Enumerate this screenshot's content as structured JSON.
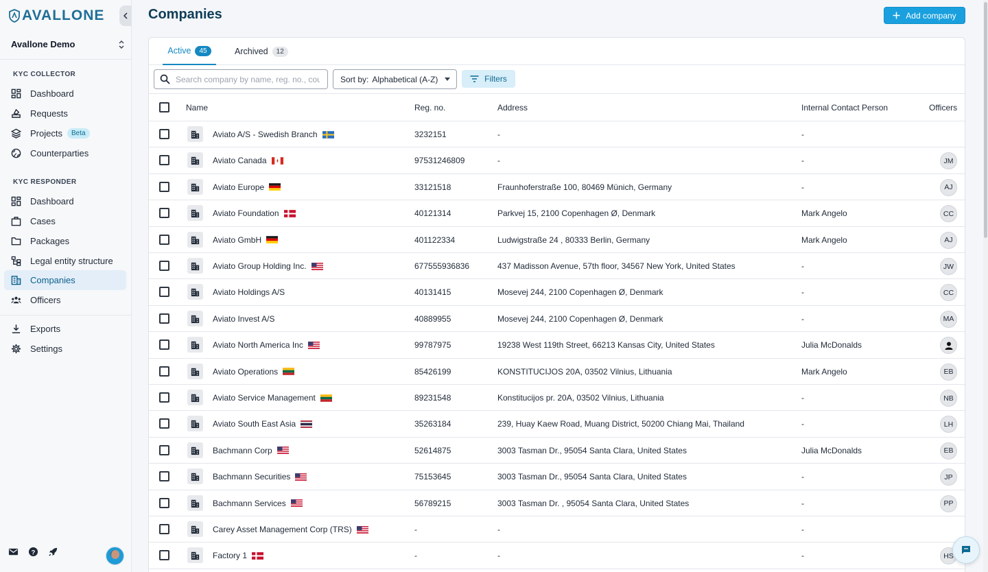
{
  "app": {
    "logo_text": "AVALLONE",
    "workspace": "Avallone Demo"
  },
  "sidebar": {
    "sections": [
      {
        "label": "KYC COLLECTOR",
        "items": [
          {
            "label": "Dashboard",
            "icon": "dashboard-icon"
          },
          {
            "label": "Requests",
            "icon": "requests-icon"
          },
          {
            "label": "Projects",
            "icon": "layers-icon",
            "badge": "Beta"
          },
          {
            "label": "Counterparties",
            "icon": "globe-icon"
          }
        ]
      },
      {
        "label": "KYC RESPONDER",
        "items": [
          {
            "label": "Dashboard",
            "icon": "dashboard-icon"
          },
          {
            "label": "Cases",
            "icon": "briefcase-icon"
          },
          {
            "label": "Packages",
            "icon": "folder-icon"
          },
          {
            "label": "Legal entity structure",
            "icon": "hierarchy-icon"
          },
          {
            "label": "Companies",
            "icon": "building-icon",
            "active": true
          },
          {
            "label": "Officers",
            "icon": "people-icon"
          }
        ]
      }
    ],
    "footer_items": [
      {
        "label": "Exports",
        "icon": "download-icon"
      },
      {
        "label": "Settings",
        "icon": "gear-icon"
      }
    ]
  },
  "page": {
    "title": "Companies",
    "add_button": "Add company"
  },
  "tabs": [
    {
      "label": "Active",
      "count": "45",
      "active": true
    },
    {
      "label": "Archived",
      "count": "12",
      "active": false
    }
  ],
  "toolbar": {
    "search_placeholder": "Search company by name, reg. no., country",
    "sort_label": "Sort by:",
    "sort_value": "Alphabetical (A-Z)",
    "filters_label": "Filters"
  },
  "table": {
    "columns": [
      "Name",
      "Reg. no.",
      "Address",
      "Internal Contact Person",
      "Officers"
    ],
    "rows": [
      {
        "name": "Aviato A/S - Swedish Branch",
        "flag": "SE",
        "reg": "3232151",
        "address": "-",
        "contact": "-",
        "officer": ""
      },
      {
        "name": "Aviato Canada",
        "flag": "CA",
        "reg": "97531246809",
        "address": "-",
        "contact": "-",
        "officer": "JM"
      },
      {
        "name": "Aviato Europe",
        "flag": "DE",
        "reg": "33121518",
        "address": "Fraunhoferstraße 100, 80469 Münich, Germany",
        "contact": "-",
        "officer": "AJ"
      },
      {
        "name": "Aviato Foundation",
        "flag": "DK",
        "reg": "40121314",
        "address": "Parkvej 15, 2100 Copenhagen Ø, Denmark",
        "contact": "Mark Angelo",
        "officer": "CC"
      },
      {
        "name": "Aviato GmbH",
        "flag": "DE",
        "reg": "401122334",
        "address": "Ludwigstraße 24 , 80333 Berlin, Germany",
        "contact": "Mark Angelo",
        "officer": "AJ"
      },
      {
        "name": "Aviato Group Holding Inc.",
        "flag": "US",
        "reg": "677555936836",
        "address": "437 Madisson Avenue, 57th floor, 34567 New York, United States",
        "contact": "-",
        "officer": "JW"
      },
      {
        "name": "Aviato Holdings A/S",
        "flag": "",
        "reg": "40131415",
        "address": "Mosevej 244, 2100 Copenhagen Ø, Denmark",
        "contact": "-",
        "officer": "CC"
      },
      {
        "name": "Aviato Invest A/S",
        "flag": "",
        "reg": "40889955",
        "address": "Mosevej 244, 2100 Copenhagen Ø, Denmark",
        "contact": "-",
        "officer": "MA"
      },
      {
        "name": "Aviato North America Inc",
        "flag": "US",
        "reg": "99787975",
        "address": "19238 West 119th Street, 66213 Kansas City, United States",
        "contact": "Julia McDonalds",
        "officer": "person-icon"
      },
      {
        "name": "Aviato Operations",
        "flag": "LT",
        "reg": "85426199",
        "address": "KONSTITUCIJOS 20A, 03502 Vilnius, Lithuania",
        "contact": "Mark Angelo",
        "officer": "EB"
      },
      {
        "name": "Aviato Service Management",
        "flag": "LT",
        "reg": "89231548",
        "address": "Konstitucijos pr. 20A, 03502 Vilnius, Lithuania",
        "contact": "-",
        "officer": "NB"
      },
      {
        "name": "Aviato South East Asia",
        "flag": "TH",
        "reg": "35263184",
        "address": "239, Huay Kaew Road, Muang District, 50200 Chiang Mai, Thailand",
        "contact": "-",
        "officer": "LH"
      },
      {
        "name": "Bachmann Corp",
        "flag": "US",
        "reg": "52614875",
        "address": "3003 Tasman Dr., 95054 Santa Clara, United States",
        "contact": "Julia McDonalds",
        "officer": "EB"
      },
      {
        "name": "Bachmann Securities",
        "flag": "US",
        "reg": "75153645",
        "address": "3003 Tasman Dr., 95054 Santa Clara, United States",
        "contact": "-",
        "officer": "JP"
      },
      {
        "name": "Bachmann Services",
        "flag": "US",
        "reg": "56789215",
        "address": "3003 Tasman Dr. , 95054 Santa Clara, United States",
        "contact": "-",
        "officer": "PP"
      },
      {
        "name": "Carey Asset Management Corp (TRS)",
        "flag": "US",
        "reg": "-",
        "address": "-",
        "contact": "-",
        "officer": ""
      },
      {
        "name": "Factory 1",
        "flag": "DK",
        "reg": "-",
        "address": "-",
        "contact": "-",
        "officer": "HS"
      }
    ]
  },
  "colors": {
    "accent": "#1aa0de",
    "title": "#0f3d57",
    "active_nav_bg": "#e3eef8"
  }
}
